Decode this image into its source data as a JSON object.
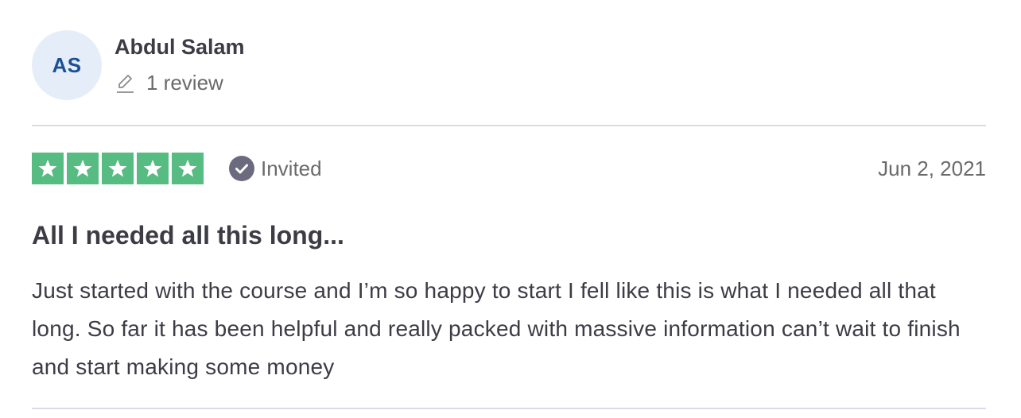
{
  "consumer": {
    "initials": "AS",
    "name": "Abdul Salam",
    "review_count": "1 review",
    "avatar_bg": "#e5eef8",
    "avatar_fg": "#1c4f94"
  },
  "rating": {
    "stars": 5,
    "max_stars": 5,
    "star_color": "#56bc81",
    "icon": "star-icon"
  },
  "verification": {
    "label": "Invited",
    "icon": "check-circle-icon"
  },
  "review": {
    "date": "Jun 2, 2021",
    "title": "All I needed all this long...",
    "body": "Just started with the course and I’m so happy to start I fell like this is what I needed all that long. So far it has been helpful and really packed with massive information can’t wait to finish and start making some money"
  }
}
